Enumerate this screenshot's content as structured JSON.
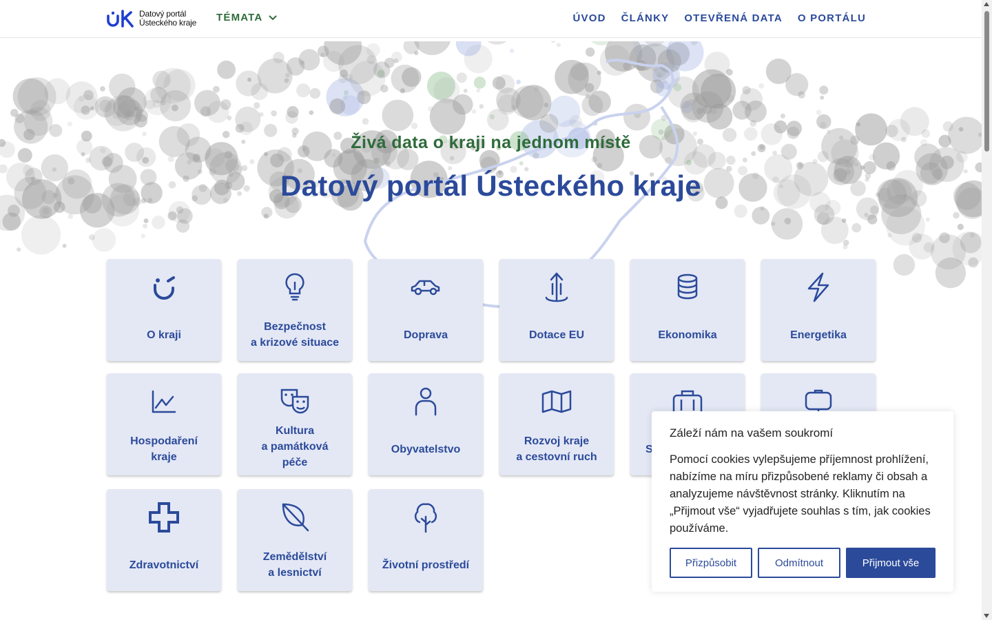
{
  "header": {
    "logo_line1": "Datový portál",
    "logo_line2": "Ústeckého kraje",
    "topics_label": "TÉMATA",
    "nav": [
      "ÚVOD",
      "ČLÁNKY",
      "OTEVŘENÁ DATA",
      "O PORTÁLU"
    ]
  },
  "hero": {
    "tagline": "Živá data o kraji na jednom místě",
    "title": "Datový portál Ústeckého kraje"
  },
  "tiles": [
    {
      "label": "O kraji",
      "icon": "region-logo-icon"
    },
    {
      "label": "Bezpečnost\na krizové situace",
      "icon": "lightbulb-icon"
    },
    {
      "label": "Doprava",
      "icon": "car-icon"
    },
    {
      "label": "Dotace EU",
      "icon": "arrow-up-icon"
    },
    {
      "label": "Ekonomika",
      "icon": "coins-stack-icon"
    },
    {
      "label": "Energetika",
      "icon": "lightning-icon"
    },
    {
      "label": "Hospodaření\nkraje",
      "icon": "line-chart-icon"
    },
    {
      "label": "Kultura\na památková\npéče",
      "icon": "theater-masks-icon"
    },
    {
      "label": "Obyvatelstvo",
      "icon": "person-icon"
    },
    {
      "label": "Rozvoj kraje\na cestovní ruch",
      "icon": "map-icon"
    },
    {
      "label": "S",
      "icon": "briefcase-icon"
    },
    {
      "label": "",
      "icon": "presentation-icon"
    },
    {
      "label": "Zdravotnictví",
      "icon": "medical-cross-icon"
    },
    {
      "label": "Zemědělství\na lesnictví",
      "icon": "leaf-icon"
    },
    {
      "label": "Životní prostředí",
      "icon": "tree-icon"
    }
  ],
  "cookie": {
    "title": "Záleží nám na vašem soukromí",
    "text": "Pomocí cookies vylepšujeme příjemnost prohlížení, nabízíme na míru přizpůsobené reklamy či obsah a analyzujeme návštěvnost stránky. Kliknutím na „Přijmout vše“ vyjadřujete souhlas s tím, jak cookies používáme.",
    "customize_label": "Přizpůsobit",
    "reject_label": "Odmítnout",
    "accept_label": "Přijmout vše"
  },
  "colors": {
    "primary": "#2b4a9a",
    "green": "#2e6b3a",
    "tile_bg": "#e4e8f5"
  }
}
